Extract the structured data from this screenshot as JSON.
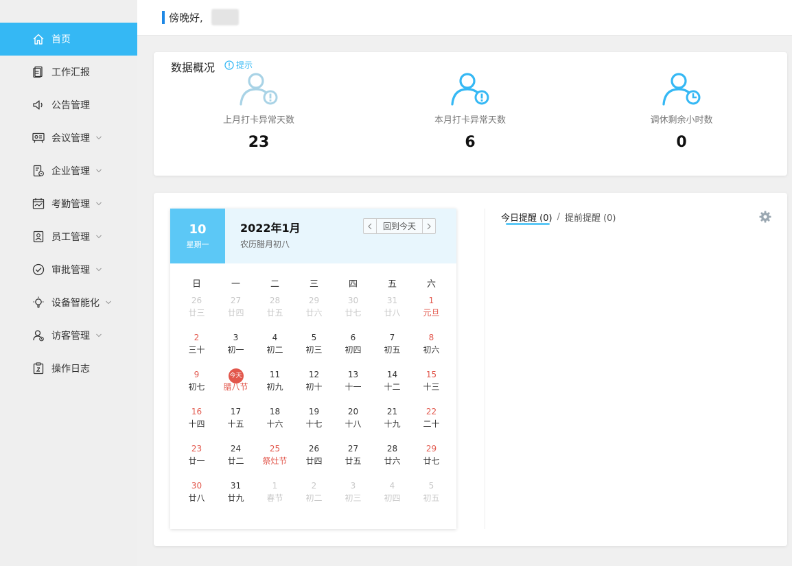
{
  "colors": {
    "accent": "#35b8f4",
    "holiday": "#e2574c",
    "today_box": "#5cc8f6",
    "greet_bar": "#1e88e5"
  },
  "sidebar": {
    "items": [
      {
        "label": "首页",
        "icon": "home-icon",
        "active": true,
        "expandable": false
      },
      {
        "label": "工作汇报",
        "icon": "report-icon",
        "active": false,
        "expandable": false
      },
      {
        "label": "公告管理",
        "icon": "megaphone-icon",
        "active": false,
        "expandable": false
      },
      {
        "label": "会议管理",
        "icon": "meeting-icon",
        "active": false,
        "expandable": true
      },
      {
        "label": "企业管理",
        "icon": "enterprise-icon",
        "active": false,
        "expandable": true
      },
      {
        "label": "考勤管理",
        "icon": "attendance-icon",
        "active": false,
        "expandable": true
      },
      {
        "label": "员工管理",
        "icon": "employee-icon",
        "active": false,
        "expandable": true
      },
      {
        "label": "审批管理",
        "icon": "approval-icon",
        "active": false,
        "expandable": true
      },
      {
        "label": "设备智能化",
        "icon": "bulb-icon",
        "active": false,
        "expandable": true
      },
      {
        "label": "访客管理",
        "icon": "visitor-icon",
        "active": false,
        "expandable": true
      },
      {
        "label": "操作日志",
        "icon": "log-icon",
        "active": false,
        "expandable": false
      }
    ]
  },
  "header": {
    "greeting": "傍晚好,"
  },
  "overview": {
    "title": "数据概况",
    "tip": "提示",
    "stats": [
      {
        "label": "上月打卡异常天数",
        "value": "23",
        "icon": "user-alert-icon"
      },
      {
        "label": "本月打卡异常天数",
        "value": "6",
        "icon": "user-alert-icon"
      },
      {
        "label": "调休剩余小时数",
        "value": "0",
        "icon": "user-clock-icon"
      }
    ]
  },
  "calendar": {
    "today_day": "10",
    "today_weekday": "星期一",
    "year_month": "2022年1月",
    "lunar": "农历腊月初八",
    "back_today": "回到今天",
    "weekdays": [
      "日",
      "一",
      "二",
      "三",
      "四",
      "五",
      "六"
    ],
    "today_badge": "今天",
    "days": [
      {
        "n": "26",
        "l": "廿三",
        "dim": true,
        "red": false,
        "fest": false
      },
      {
        "n": "27",
        "l": "廿四",
        "dim": true,
        "red": false,
        "fest": false
      },
      {
        "n": "28",
        "l": "廿五",
        "dim": true,
        "red": false,
        "fest": false
      },
      {
        "n": "29",
        "l": "廿六",
        "dim": true,
        "red": false,
        "fest": false
      },
      {
        "n": "30",
        "l": "廿七",
        "dim": true,
        "red": false,
        "fest": false
      },
      {
        "n": "31",
        "l": "廿八",
        "dim": true,
        "red": false,
        "fest": false
      },
      {
        "n": "1",
        "l": "元旦",
        "dim": false,
        "red": true,
        "fest": true
      },
      {
        "n": "2",
        "l": "三十",
        "dim": false,
        "red": true,
        "fest": false
      },
      {
        "n": "3",
        "l": "初一",
        "dim": false,
        "red": false,
        "fest": false
      },
      {
        "n": "4",
        "l": "初二",
        "dim": false,
        "red": false,
        "fest": false
      },
      {
        "n": "5",
        "l": "初三",
        "dim": false,
        "red": false,
        "fest": false
      },
      {
        "n": "6",
        "l": "初四",
        "dim": false,
        "red": false,
        "fest": false
      },
      {
        "n": "7",
        "l": "初五",
        "dim": false,
        "red": false,
        "fest": false
      },
      {
        "n": "8",
        "l": "初六",
        "dim": false,
        "red": true,
        "fest": false
      },
      {
        "n": "9",
        "l": "初七",
        "dim": false,
        "red": true,
        "fest": false
      },
      {
        "n": "10",
        "l": "腊八节",
        "dim": false,
        "red": false,
        "fest": true,
        "today": true
      },
      {
        "n": "11",
        "l": "初九",
        "dim": false,
        "red": false,
        "fest": false
      },
      {
        "n": "12",
        "l": "初十",
        "dim": false,
        "red": false,
        "fest": false
      },
      {
        "n": "13",
        "l": "十一",
        "dim": false,
        "red": false,
        "fest": false
      },
      {
        "n": "14",
        "l": "十二",
        "dim": false,
        "red": false,
        "fest": false
      },
      {
        "n": "15",
        "l": "十三",
        "dim": false,
        "red": true,
        "fest": false
      },
      {
        "n": "16",
        "l": "十四",
        "dim": false,
        "red": true,
        "fest": false
      },
      {
        "n": "17",
        "l": "十五",
        "dim": false,
        "red": false,
        "fest": false
      },
      {
        "n": "18",
        "l": "十六",
        "dim": false,
        "red": false,
        "fest": false
      },
      {
        "n": "19",
        "l": "十七",
        "dim": false,
        "red": false,
        "fest": false
      },
      {
        "n": "20",
        "l": "十八",
        "dim": false,
        "red": false,
        "fest": false
      },
      {
        "n": "21",
        "l": "十九",
        "dim": false,
        "red": false,
        "fest": false
      },
      {
        "n": "22",
        "l": "二十",
        "dim": false,
        "red": true,
        "fest": false
      },
      {
        "n": "23",
        "l": "廿一",
        "dim": false,
        "red": true,
        "fest": false
      },
      {
        "n": "24",
        "l": "廿二",
        "dim": false,
        "red": false,
        "fest": false
      },
      {
        "n": "25",
        "l": "祭灶节",
        "dim": false,
        "red": true,
        "fest": true
      },
      {
        "n": "26",
        "l": "廿四",
        "dim": false,
        "red": false,
        "fest": false
      },
      {
        "n": "27",
        "l": "廿五",
        "dim": false,
        "red": false,
        "fest": false
      },
      {
        "n": "28",
        "l": "廿六",
        "dim": false,
        "red": false,
        "fest": false
      },
      {
        "n": "29",
        "l": "廿七",
        "dim": false,
        "red": true,
        "fest": false
      },
      {
        "n": "30",
        "l": "廿八",
        "dim": false,
        "red": true,
        "fest": false
      },
      {
        "n": "31",
        "l": "廿九",
        "dim": false,
        "red": false,
        "fest": false
      },
      {
        "n": "1",
        "l": "春节",
        "dim": true,
        "red": false,
        "fest": false
      },
      {
        "n": "2",
        "l": "初二",
        "dim": true,
        "red": false,
        "fest": false
      },
      {
        "n": "3",
        "l": "初三",
        "dim": true,
        "red": false,
        "fest": false
      },
      {
        "n": "4",
        "l": "初四",
        "dim": true,
        "red": false,
        "fest": false
      },
      {
        "n": "5",
        "l": "初五",
        "dim": true,
        "red": false,
        "fest": false
      }
    ]
  },
  "reminders": {
    "today_tab": "今日提醒 (0)",
    "sep": "/",
    "advance_tab": "提前提醒 (0)",
    "settings_icon": "gear-icon"
  }
}
